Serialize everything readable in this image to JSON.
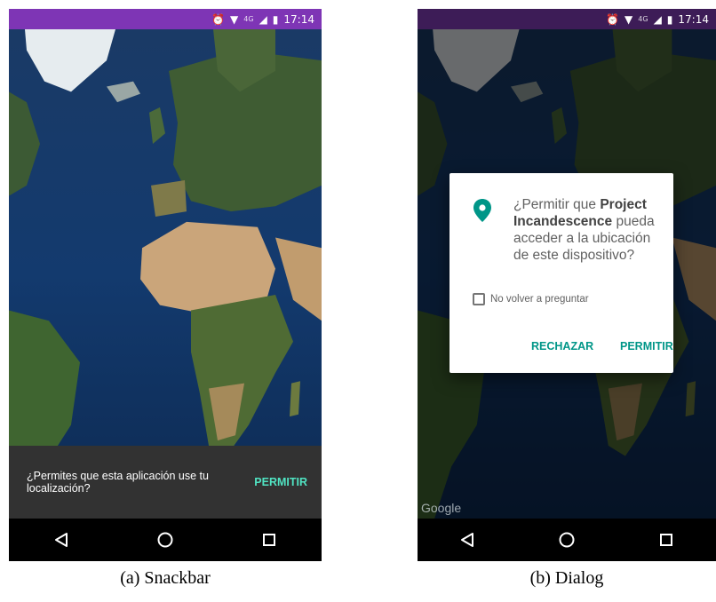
{
  "colors": {
    "status_bar": "#7e35b5",
    "snackbar_bg": "#323232",
    "snackbar_action": "#50e3c2",
    "dialog_accent": "#009688"
  },
  "screens": [
    {
      "status": {
        "time": "17:14",
        "network": "4G",
        "icons": [
          "alarm-icon",
          "wifi-icon",
          "signal-icon",
          "battery-icon"
        ]
      },
      "snackbar": {
        "message": "¿Permites que esta aplicación use tu localización?",
        "action": "PERMITIR"
      },
      "nav": [
        "back-icon",
        "home-icon",
        "recents-icon"
      ]
    },
    {
      "status": {
        "time": "17:14",
        "network": "4G",
        "icons": [
          "alarm-icon",
          "wifi-icon",
          "signal-icon",
          "battery-icon"
        ]
      },
      "map_attribution": "Google",
      "dialog": {
        "icon": "location-pin-icon",
        "message_prefix": "¿Permitir que ",
        "app_name": "Project Incandescence",
        "message_suffix": " pueda acceder a la ubicación de este dispositivo?",
        "checkbox_label": "No volver a preguntar",
        "deny_label": "RECHAZAR",
        "allow_label": "PERMITIR"
      },
      "nav": [
        "back-icon",
        "home-icon",
        "recents-icon"
      ]
    }
  ],
  "captions": [
    "(a) Snackbar",
    "(b) Dialog"
  ]
}
